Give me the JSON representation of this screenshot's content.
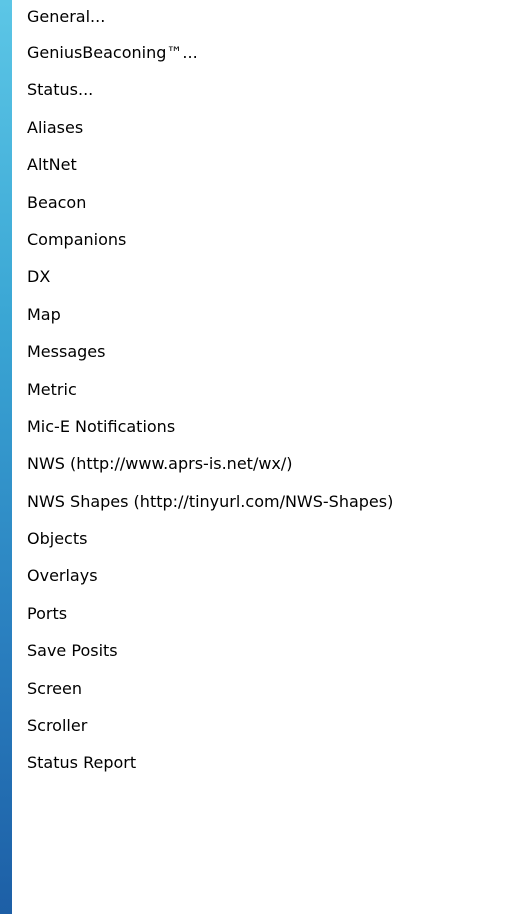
{
  "menu": {
    "items": [
      {
        "label": "General...",
        "id": "general"
      },
      {
        "label": "GeniusBeaconing™...",
        "id": "geniusbeaconing"
      },
      {
        "label": "Status...",
        "id": "status"
      },
      {
        "label": "Aliases",
        "id": "aliases"
      },
      {
        "label": "AltNet",
        "id": "altnet"
      },
      {
        "label": "Beacon",
        "id": "beacon"
      },
      {
        "label": "Companions",
        "id": "companions"
      },
      {
        "label": "DX",
        "id": "dx"
      },
      {
        "label": "Map",
        "id": "map"
      },
      {
        "label": "Messages",
        "id": "messages"
      },
      {
        "label": "Metric",
        "id": "metric"
      },
      {
        "label": "Mic-E Notifications",
        "id": "mic-e-notifications"
      },
      {
        "label": "NWS (http://www.aprs-is.net/wx/)",
        "id": "nws"
      },
      {
        "label": "NWS Shapes (http://tinyurl.com/NWS-Shapes)",
        "id": "nws-shapes"
      },
      {
        "label": "Objects",
        "id": "objects"
      },
      {
        "label": "Overlays",
        "id": "overlays"
      },
      {
        "label": "Ports",
        "id": "ports"
      },
      {
        "label": "Save Posits",
        "id": "save-posits"
      },
      {
        "label": "Screen",
        "id": "screen"
      },
      {
        "label": "Scroller",
        "id": "scroller"
      },
      {
        "label": "Status Report",
        "id": "status-report"
      }
    ]
  },
  "colors": {
    "accent_strip_top": "#5cc6e6",
    "accent_strip_bottom": "#1d5fa6",
    "menu_background": "#ffffff",
    "text": "#000000"
  }
}
